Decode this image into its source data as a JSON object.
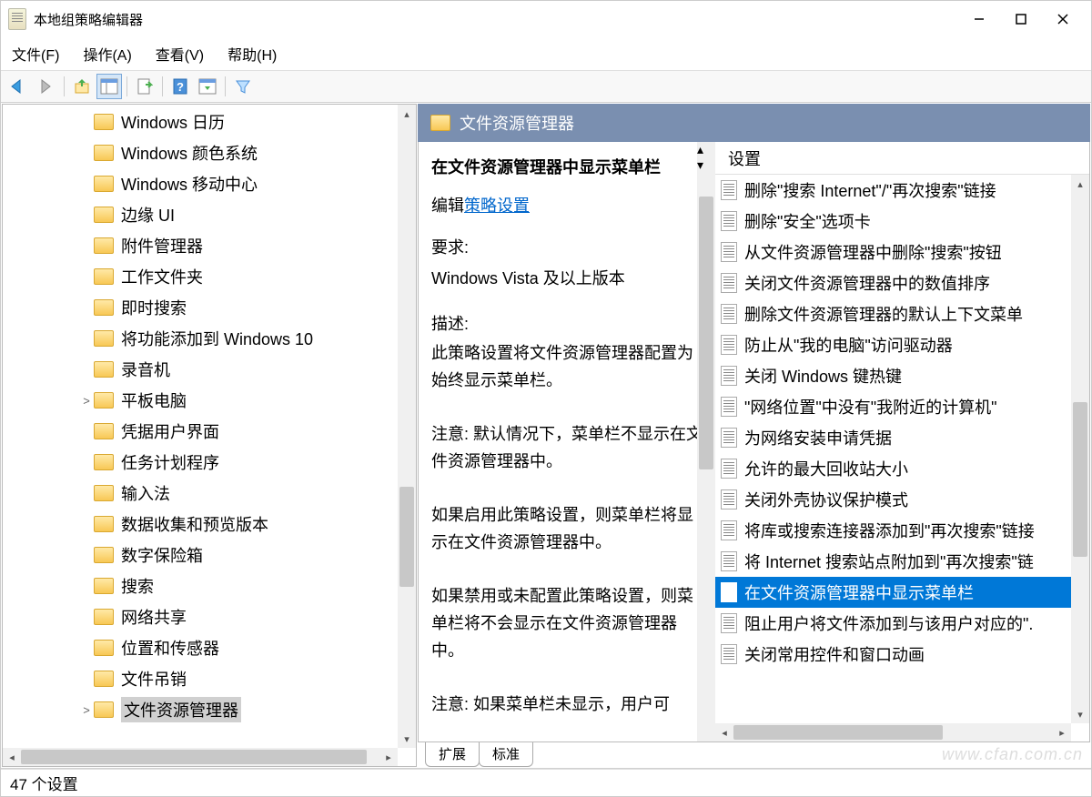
{
  "window": {
    "title": "本地组策略编辑器"
  },
  "menu": {
    "file": "文件(F)",
    "action": "操作(A)",
    "view": "查看(V)",
    "help": "帮助(H)"
  },
  "tree": {
    "items": [
      {
        "label": "Windows 日历",
        "exp": false
      },
      {
        "label": "Windows 颜色系统",
        "exp": false
      },
      {
        "label": "Windows 移动中心",
        "exp": false
      },
      {
        "label": "边缘 UI",
        "exp": false
      },
      {
        "label": "附件管理器",
        "exp": false
      },
      {
        "label": "工作文件夹",
        "exp": false
      },
      {
        "label": "即时搜索",
        "exp": false
      },
      {
        "label": "将功能添加到 Windows 10",
        "exp": false
      },
      {
        "label": "录音机",
        "exp": false
      },
      {
        "label": "平板电脑",
        "exp": true
      },
      {
        "label": "凭据用户界面",
        "exp": false
      },
      {
        "label": "任务计划程序",
        "exp": false
      },
      {
        "label": "输入法",
        "exp": false
      },
      {
        "label": "数据收集和预览版本",
        "exp": false
      },
      {
        "label": "数字保险箱",
        "exp": false
      },
      {
        "label": "搜索",
        "exp": false
      },
      {
        "label": "网络共享",
        "exp": false
      },
      {
        "label": "位置和传感器",
        "exp": false
      },
      {
        "label": "文件吊销",
        "exp": false
      },
      {
        "label": "文件资源管理器",
        "exp": true,
        "selected": true
      }
    ]
  },
  "detail": {
    "headerTitle": "文件资源管理器",
    "policyTitle": "在文件资源管理器中显示菜单栏",
    "editLabel": "编辑",
    "editLink": "策略设置",
    "reqLabel": "要求:",
    "reqValue": "Windows Vista 及以上版本",
    "descLabel": "描述:",
    "descText": "此策略设置将文件资源管理器配置为始终显示菜单栏。\n\n注意: 默认情况下，菜单栏不显示在文件资源管理器中。\n\n如果启用此策略设置，则菜单栏将显示在文件资源管理器中。\n\n如果禁用或未配置此策略设置，则菜单栏将不会显示在文件资源管理器中。\n\n注意: 如果菜单栏未显示，用户可"
  },
  "settings": {
    "header": "设置",
    "items": [
      "删除\"搜索 Internet\"/\"再次搜索\"链接",
      "删除\"安全\"选项卡",
      "从文件资源管理器中删除\"搜索\"按钮",
      "关闭文件资源管理器中的数值排序",
      "删除文件资源管理器的默认上下文菜单",
      "防止从\"我的电脑\"访问驱动器",
      "关闭 Windows 键热键",
      "\"网络位置\"中没有\"我附近的计算机\"",
      "为网络安装申请凭据",
      "允许的最大回收站大小",
      "关闭外壳协议保护模式",
      "将库或搜索连接器添加到\"再次搜索\"链接",
      "将 Internet 搜索站点附加到\"再次搜索\"链",
      "在文件资源管理器中显示菜单栏",
      "阻止用户将文件添加到与该用户对应的\".",
      "关闭常用控件和窗口动画"
    ],
    "selectedIndex": 13
  },
  "tabs": {
    "extend": "扩展",
    "standard": "标准"
  },
  "statusbar": "47 个设置",
  "watermark": "www.cfan.com.cn"
}
